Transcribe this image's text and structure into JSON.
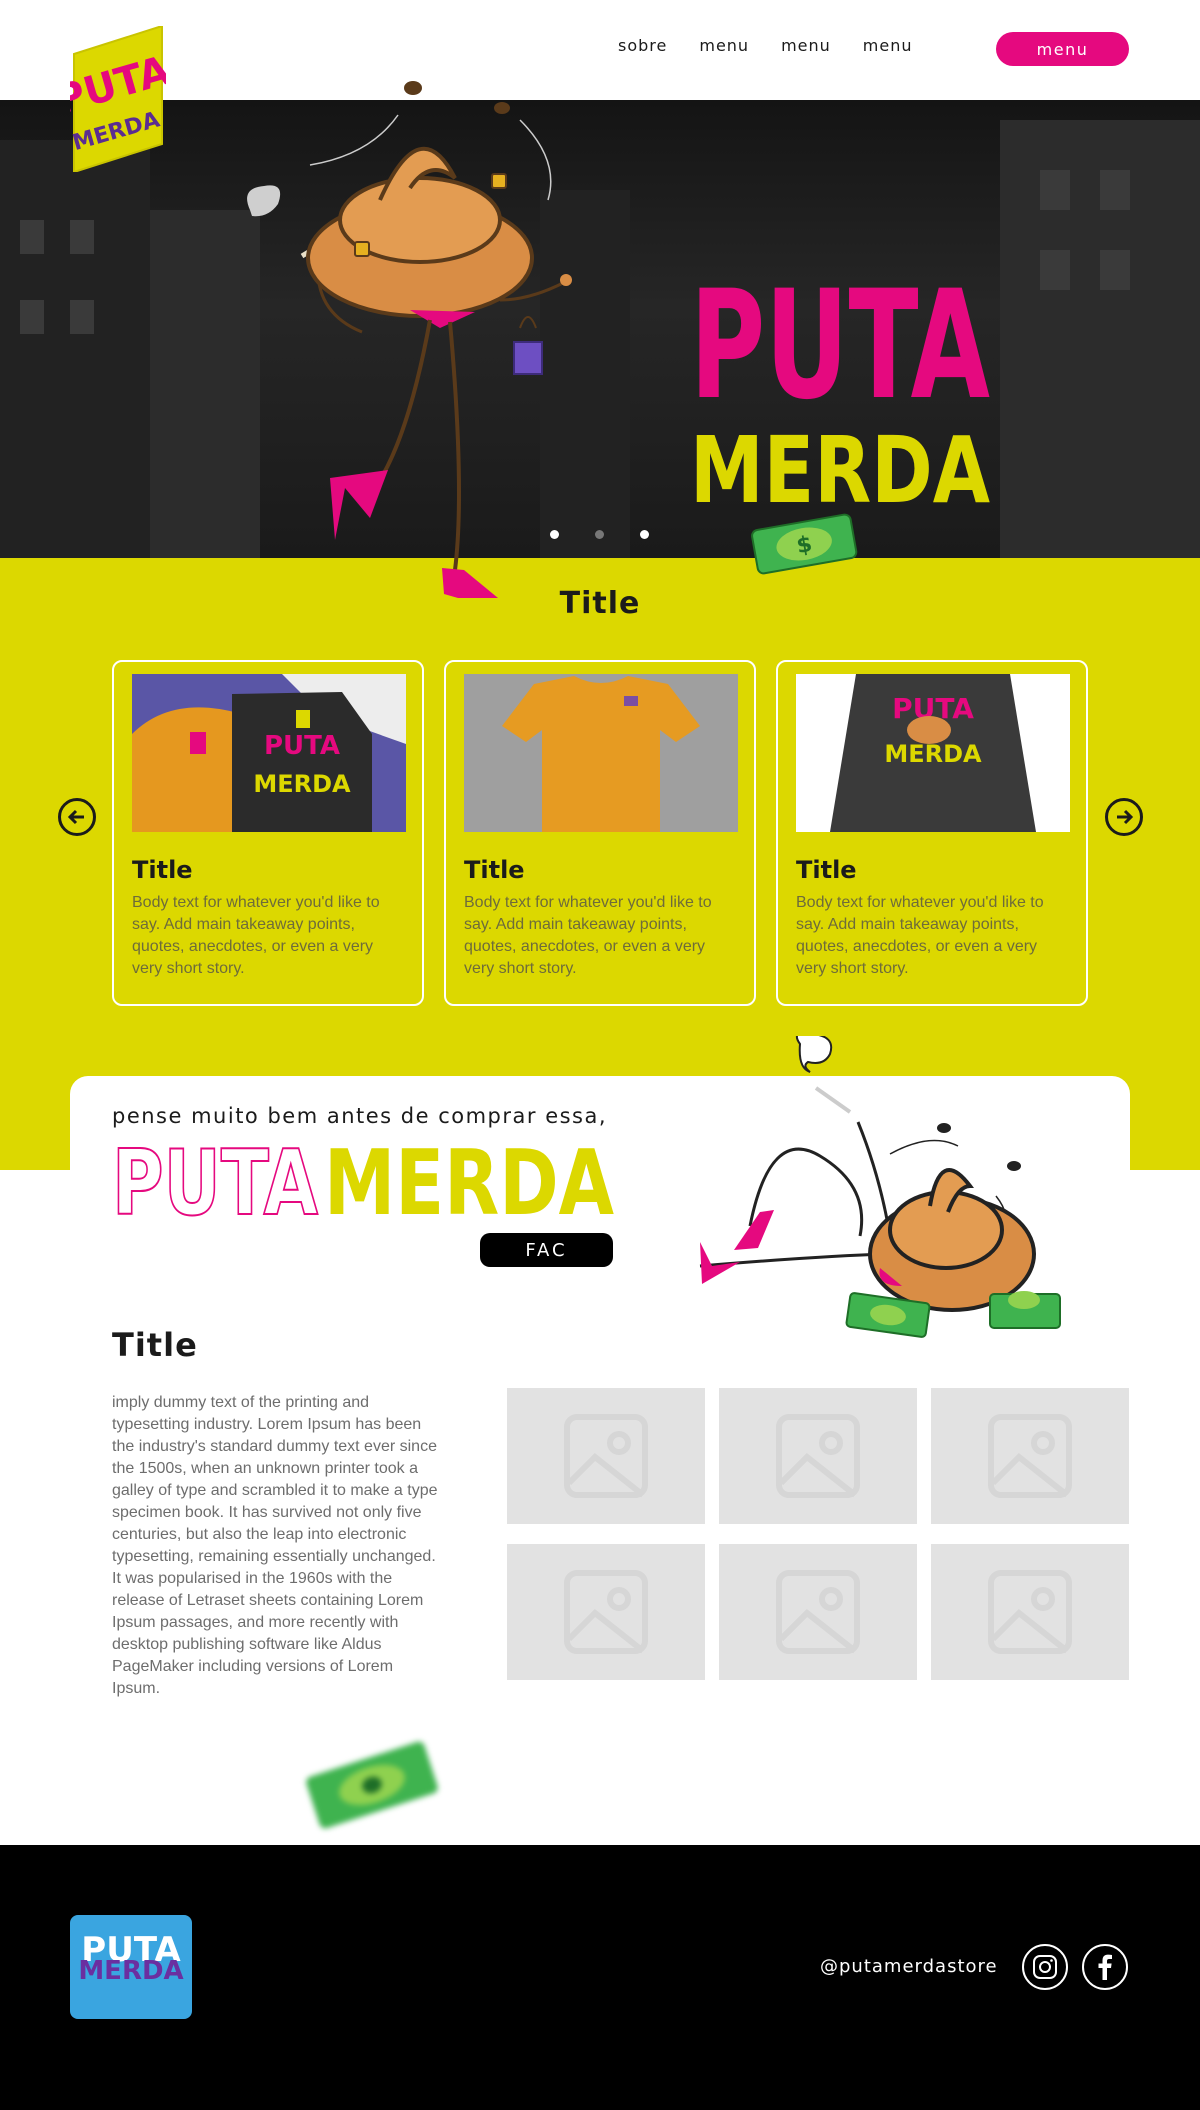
{
  "header": {
    "nav": [
      "sobre",
      "menu",
      "menu",
      "menu"
    ],
    "cta_label": "menu",
    "logo_text": [
      "PUTA",
      "MERDA"
    ]
  },
  "hero": {
    "title_line1": "PUTA",
    "title_line2": "MERDA",
    "carousel": {
      "slides": 3,
      "active": 1
    },
    "bill_symbol": "$"
  },
  "products": {
    "title": "Title",
    "prev_icon": "arrow-left-circle-icon",
    "next_icon": "arrow-right-circle-icon",
    "cards": [
      {
        "title": "Title",
        "body": "Body text for whatever you'd like to say. Add main takeaway points, quotes, anecdotes, or even a very very short story.",
        "image": "folded-shirts-photo",
        "print_text": [
          "PUTA",
          "MERDA"
        ]
      },
      {
        "title": "Title",
        "body": "Body text for whatever you'd like to say. Add main takeaway points, quotes, anecdotes, or even a very very short story.",
        "image": "orange-tshirt-photo"
      },
      {
        "title": "Title",
        "body": "Body text for whatever you'd like to say. Add main takeaway points, quotes, anecdotes, or even a very very short story.",
        "image": "black-hoodie-photo",
        "print_text": [
          "PUTA",
          "MERDA"
        ]
      }
    ]
  },
  "promo": {
    "tagline": "pense muito bem antes de comprar essa,",
    "word_outline": "PUTA",
    "word_solid": "MERDA",
    "button_label": "FAC"
  },
  "about": {
    "title": "Title",
    "text": "imply dummy text of the printing and typesetting industry. Lorem Ipsum has been the industry's standard dummy text ever since the 1500s, when an unknown printer took a galley of type and scrambled it to make a type specimen book. It has survived not only five centuries, but also the leap into electronic typesetting, remaining essentially unchanged. It was popularised in the 1960s with the release of Letraset sheets containing Lorem Ipsum passages, and more recently with desktop publishing software like Aldus PageMaker including versions of Lorem Ipsum.",
    "gallery_count": 6,
    "gallery_icon": "image-placeholder-icon"
  },
  "footer": {
    "logo_text": [
      "PUTA",
      "MERDA"
    ],
    "handle": "@putamerdastore",
    "social": [
      "instagram-icon",
      "facebook-icon"
    ]
  },
  "colors": {
    "pink": "#e5097f",
    "yellow": "#dcd800",
    "black": "#000000",
    "blue": "#3aa5e0",
    "poop": "#d98d45"
  }
}
